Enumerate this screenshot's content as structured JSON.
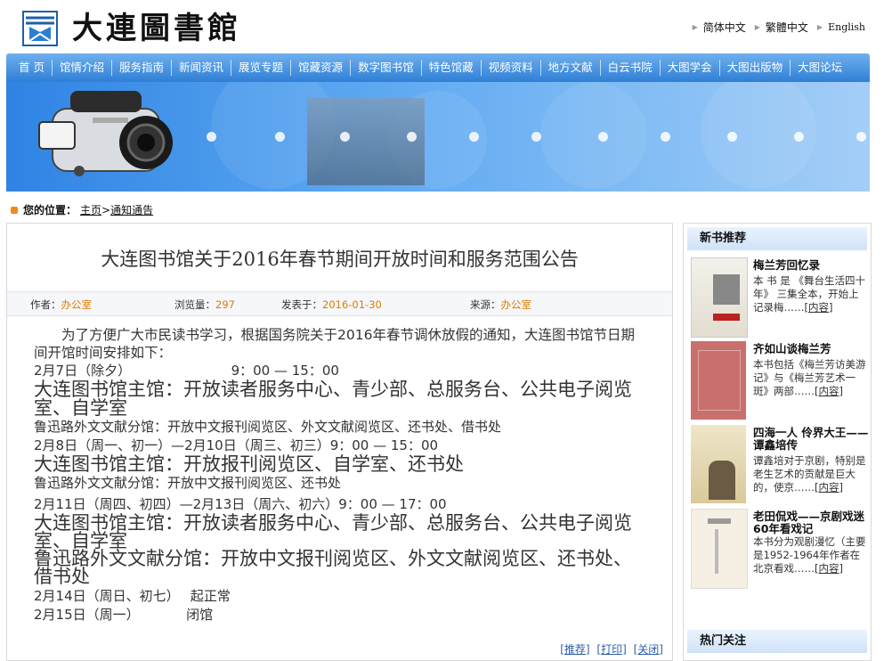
{
  "header": {
    "logo_title": "大連圖書館",
    "languages": [
      "简体中文",
      "繁體中文",
      "English"
    ]
  },
  "nav": [
    "首 页",
    "馆情介绍",
    "服务指南",
    "新闻资讯",
    "展览专题",
    "馆藏资源",
    "数字图书馆",
    "特色馆藏",
    "视频资料",
    "地方文献",
    "白云书院",
    "大图学会",
    "大图出版物",
    "大图论坛"
  ],
  "breadcrumb": {
    "label": "您的位置：",
    "home": "主页",
    "separator": ">",
    "current": "通知通告"
  },
  "article": {
    "title": "大连图书馆关于2016年春节期间开放时间和服务范围公告",
    "meta": {
      "author_label": "作者：",
      "author": "办公室",
      "views_label": "浏览量：",
      "views": "297",
      "date_label": "发表于：",
      "date": "2016-01-30",
      "source_label": "来源：",
      "source": "办公室"
    },
    "intro": "为了方便广大市民读书学习，根据国务院关于2016年春节调休放假的通知，大连图书馆节日期间开馆时间安排如下：",
    "lines": [
      "2月7日（除夕）　　　　　　　　9：00 — 15：00",
      "大连图书馆主馆：开放读者服务中心、青少部、总服务台、公共电子阅览室、自学室",
      "鲁迅路外文文献分馆：开放中文报刊阅览区、外文文献阅览区、还书处、借书处",
      "2月8日（周一、初一）—2月10日（周三、初三）9：00 — 15：00",
      "大连图书馆主馆：开放报刊阅览区、自学室、还书处",
      "鲁迅路外文文献分馆：开放中文报刊阅览区、还书处",
      "2月11日（周四、初四）—2月13日（周六、初六）9：00 — 17：00",
      "大连图书馆主馆：开放读者服务中心、青少部、总服务台、公共电子阅览室、自学室",
      "鲁迅路外文文献分馆：开放中文报刊阅览区、外文文献阅览区、还书处、借书处",
      "2月14日（周日、初七）　 起正常",
      "2月15日（周一）　　　　闭馆"
    ],
    "footer": [
      "[推荐]",
      "[打印]",
      "[关闭]"
    ]
  },
  "sidebar": {
    "heading": "新书推荐",
    "books": [
      {
        "title": "梅兰芳回忆录",
        "desc": "本 书 是 《舞台生活四十年》 三集全本，开始上记录梅……",
        "more": "[内容]"
      },
      {
        "title": "齐如山谈梅兰芳",
        "desc": "本书包括《梅兰芳访美游记》与《梅兰芳艺术一斑》两部……",
        "more": "[内容]"
      },
      {
        "title": "四海一人 伶界大王——谭鑫培传",
        "desc": "谭鑫培对于京剧，特别是老生艺术的贡献是巨大的，使京……",
        "more": "[内容]"
      },
      {
        "title": "老田侃戏——京剧戏迷60年看戏记",
        "desc": "本书分为观剧漫忆（主要是1952-1964年作者在北京看戏……",
        "more": "[内容]"
      }
    ],
    "heading2": "热门关注"
  },
  "colors": {
    "nav": "#2f7fd6",
    "accent": "#e07b00",
    "bullet": "#f08a1c"
  }
}
